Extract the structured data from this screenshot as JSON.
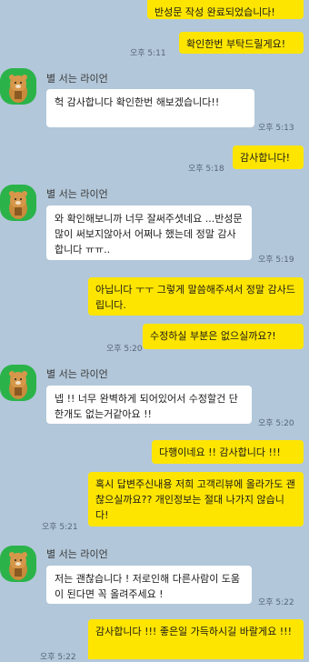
{
  "sender_name": "별 서는 라이언",
  "messages": [
    {
      "text": "반성문 작성 완료되었습니다!"
    },
    {
      "text": "확인한번 부탁드릴게요!",
      "time": "오후 5:11"
    },
    {
      "text": "헉 감사합니다 확인한번 해보겠습니다!!",
      "time": "오후 5:13"
    },
    {
      "text": "감사합니다!",
      "time": "오후 5:18"
    },
    {
      "text": "와 확인해보니까 너무 잘써주셧네요 ...반성문 많이 써보지않아서 어쩌나 했는데 정말 감사합니다 ㅠㅠ..",
      "time": "오후 5:19"
    },
    {
      "text": "아닙니다 ㅜㅜ 그렇게 말씀해주셔서 정말 감사드립니다."
    },
    {
      "text": "수정하실 부분은 없으실까요?!",
      "time": "오후 5:20"
    },
    {
      "text": "넵 !! 너무 완벽하게 되어있어서 수정할건 단 한개도 없는거같아요 !!",
      "time": "오후 5:20"
    },
    {
      "text": "다행이네요 !! 감사합니다 !!!"
    },
    {
      "text": "혹시 답변주신내용 저희 고객리뷰에 올라가도 괜찮으실까요?? 개인정보는 절대 나가지 않습니다!",
      "time": "오후 5:21"
    },
    {
      "text": "저는 괜찮습니다 ! 저로인해 다른사람이 도움이 된다면 꼭 올려주세요 !",
      "time": "오후 5:22"
    },
    {
      "text": "감사합니다 !!! 좋은일 가득하시길 바랄게요 !!!",
      "time": "오후 5:22"
    }
  ],
  "colors": {
    "background": "#b2c7d9",
    "my_bubble": "#fee500",
    "other_bubble": "#ffffff",
    "avatar_bg": "#2bb34a"
  },
  "avatar_icon": "ryan-character-icon"
}
